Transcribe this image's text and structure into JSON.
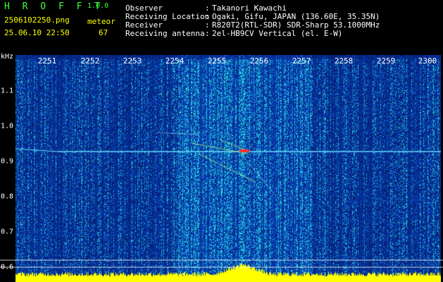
{
  "header": {
    "app_title": "H R O F F T",
    "app_version": "1.0.0",
    "filename": "2506102250.png",
    "datetime": "25.06.10 22:50",
    "detect_type": "meteor",
    "detect_count": "67"
  },
  "info": [
    {
      "label": "Observer",
      "colon": ":",
      "value": "Takanori Kawachi"
    },
    {
      "label": "Receiving Location",
      "colon": ":",
      "value": "Ogaki, Gifu, JAPAN (136.60E, 35.35N)"
    },
    {
      "label": "Receiver",
      "colon": ":",
      "value": "R820T2(RTL-SDR) SDR-Sharp 53.1000MHz"
    },
    {
      "label": "Receiving antenna",
      "colon": ":",
      "value": "2el-HB9CV Vertical (el. E-W)"
    }
  ],
  "axes": {
    "freq_unit": "kHz",
    "time_ticks": [
      "2251",
      "2252",
      "2253",
      "2254",
      "2255",
      "2256",
      "2257",
      "2258",
      "2259",
      "2300"
    ],
    "freq_ticks": [
      "1.1",
      "1.0",
      "0.9",
      "0.8",
      "0.7",
      "0.6"
    ]
  },
  "colors": {
    "background": "#000000",
    "header_green": "#3cff3c",
    "header_yellow": "#ffff00",
    "spectrum_base": "#0a1f8c",
    "carrier_line": "#66ddff",
    "echo_hot": "#ff3030",
    "level_bar": "#ffff00"
  }
}
